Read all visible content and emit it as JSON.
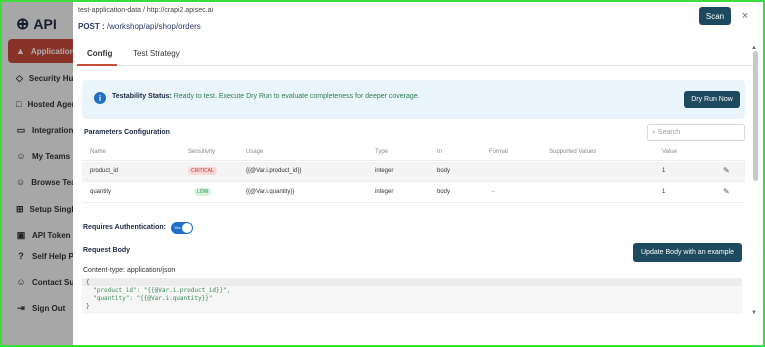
{
  "sidebar": {
    "logo": "API",
    "items": [
      {
        "label": "Applications",
        "icon": "rocket-icon"
      },
      {
        "label": "Security Hub",
        "icon": "shield-icon"
      },
      {
        "label": "Hosted Agents",
        "icon": "monitor-icon"
      },
      {
        "label": "Integrations",
        "icon": "folder-icon"
      },
      {
        "label": "My Teams",
        "icon": "users-icon"
      },
      {
        "label": "Browse Teams",
        "icon": "users-icon"
      },
      {
        "label": "Setup Single",
        "icon": "plus-box-icon"
      },
      {
        "label": "API Token",
        "icon": "key-icon"
      },
      {
        "label": "Self Help P",
        "icon": "help-icon"
      },
      {
        "label": "Contact Su",
        "icon": "contact-icon"
      },
      {
        "label": "Sign Out",
        "icon": "signout-icon"
      }
    ]
  },
  "modal": {
    "crumb": "test-application-data / http://crapi2.apisec.ai",
    "method": "POST :",
    "path": "/workshop/api/shop/orders",
    "scan_label": "Scan",
    "close_label": "×",
    "tabs": [
      "Config",
      "Test Strategy"
    ],
    "status": {
      "title": "Testability Status:",
      "message": "Ready to test. Execute Dry Run to evaluate completeness for deeper coverage.",
      "dry_run_label": "Dry Run Now"
    },
    "params": {
      "title": "Parameters Configuration",
      "search_placeholder": "Search",
      "columns": [
        "Name",
        "Sensitivity",
        "Usage",
        "Type",
        "In",
        "Format",
        "Supported Values",
        "Value"
      ],
      "rows": [
        {
          "name": "product_id",
          "sensitivity": "CRITICAL",
          "usage": "{{@Var.i.product_id}}",
          "type": "integer",
          "in": "body",
          "format": "",
          "supported": "",
          "value": "1"
        },
        {
          "name": "quantity",
          "sensitivity": "LOW",
          "usage": "{{@Var.i.quantity}}",
          "type": "integer",
          "in": "body",
          "format": "-",
          "supported": "",
          "value": "1"
        }
      ]
    },
    "auth": {
      "label": "Requires Authentication:",
      "toggle_text": "Yes"
    },
    "body": {
      "label": "Request Body",
      "update_label": "Update Body with an example",
      "content_type": "Content-type: application/json",
      "code_lines": [
        "{",
        "  \"product_id\": \"{{@Var.i.product_id}}\",",
        "  \"quantity\": \"{{@Var.i.quantity}}\"",
        "}"
      ]
    }
  },
  "colors": {
    "accent": "#c94b3c",
    "primary_button": "#1d4a5f",
    "frame": "#3ddc3d"
  }
}
